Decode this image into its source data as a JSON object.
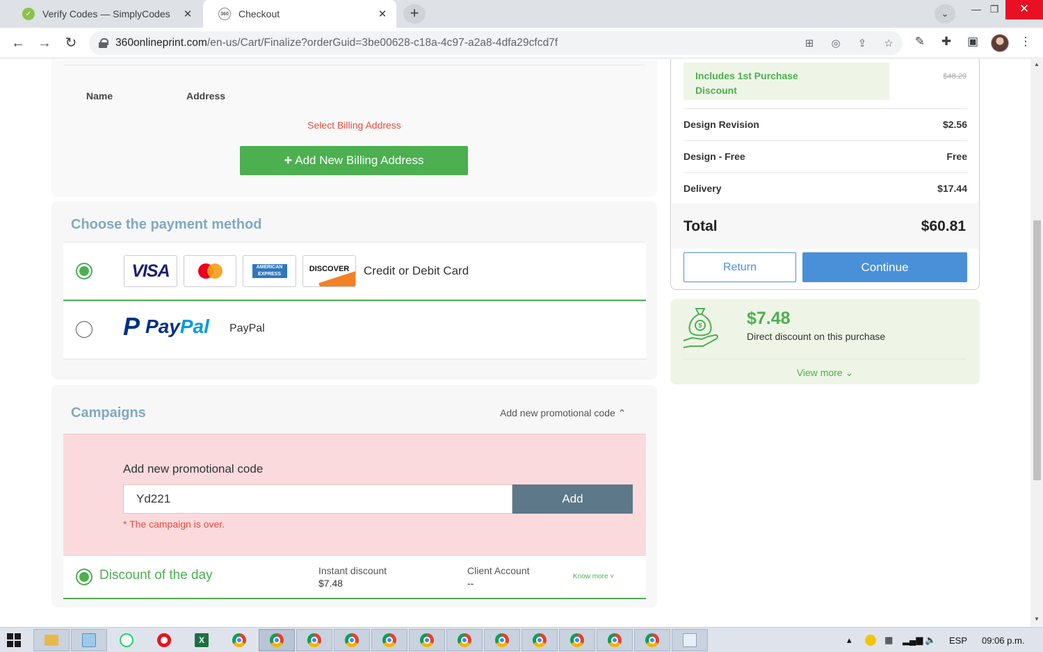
{
  "browser": {
    "tabs": [
      {
        "title": "Verify Codes — SimplyCodes",
        "favicon": "simplycodes-icon"
      },
      {
        "title": "Checkout",
        "favicon": "360-icon"
      }
    ],
    "new_tab": "+",
    "close_glyph": "✕",
    "url_host": "360onlineprint.com",
    "url_path": "/en-us/Cart/Finalize?orderGuid=3be00628-c18a-4c97-a2a8-4dfa29cfcd7f"
  },
  "billing": {
    "col_name": "Name",
    "col_address": "Address",
    "select_prompt": "Select Billing Address",
    "add_button": "Add New Billing Address"
  },
  "payment": {
    "title": "Choose the payment method",
    "card_logos": {
      "visa": "VISA",
      "amex_line1": "AMERICAN",
      "amex_line2": "EXPRESS",
      "discover": "DISCOVER"
    },
    "card_option": "Credit or Debit Card",
    "paypal_mark": "P",
    "paypal_word_a": "Pay",
    "paypal_word_b": "Pal",
    "paypal_option": "PayPal"
  },
  "campaigns": {
    "title": "Campaigns",
    "toggle": "Add new promotional code ⌃",
    "promo_heading": "Add new promotional code",
    "promo_value": "Yd221",
    "promo_button": "Add",
    "promo_error": "* The campaign is over.",
    "discount_name": "Discount of the day",
    "instant_label": "Instant discount",
    "instant_value": "$7.48",
    "client_label": "Client Account",
    "client_value": "--",
    "know_more": "Know more ˅"
  },
  "summary": {
    "discount_note": "Includes 1st Purchase Discount",
    "strike_price": "$48.29",
    "rows": [
      {
        "label": "Design Revision",
        "value": "$2.56"
      },
      {
        "label": "Design - Free",
        "value": "Free"
      },
      {
        "label": "Delivery",
        "value": "$17.44"
      }
    ],
    "total_label": "Total",
    "total_value": "$60.81",
    "return_button": "Return",
    "continue_button": "Continue"
  },
  "savings": {
    "amount": "$7.48",
    "text": "Direct discount on this purchase",
    "view_more": "View more ⌄"
  },
  "taskbar": {
    "language": "ESP",
    "time": "09:06 p.m."
  },
  "colors": {
    "green": "#4caf50",
    "blue": "#4a90d9",
    "promo_bg": "#fadadd",
    "error": "#e74c3c"
  }
}
